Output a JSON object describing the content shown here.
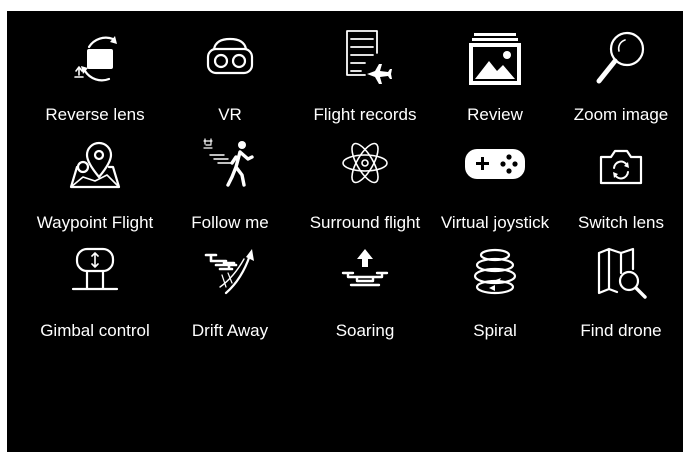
{
  "screen_title": "",
  "items": [
    {
      "id": "reverse-lens",
      "label": "Reverse lens",
      "icon": "reverse-lens-icon"
    },
    {
      "id": "vr",
      "label": "VR",
      "icon": "vr-headset-icon"
    },
    {
      "id": "flight-records",
      "label": "Flight records",
      "icon": "flight-records-icon"
    },
    {
      "id": "review",
      "label": "Review",
      "icon": "image-gallery-icon"
    },
    {
      "id": "zoom-image",
      "label": "Zoom image",
      "icon": "magnifier-icon"
    },
    {
      "id": "waypoint-flight",
      "label": "Waypoint Flight",
      "icon": "map-pin-icon"
    },
    {
      "id": "follow-me",
      "label": "Follow me",
      "icon": "follow-walker-icon"
    },
    {
      "id": "surround-flight",
      "label": "Surround flight",
      "icon": "orbit-atom-icon"
    },
    {
      "id": "virtual-joystick",
      "label": "Virtual joystick",
      "icon": "gamepad-icon"
    },
    {
      "id": "switch-lens",
      "label": "Switch lens",
      "icon": "camera-switch-icon"
    },
    {
      "id": "gimbal-control",
      "label": "Gimbal control",
      "icon": "gimbal-icon"
    },
    {
      "id": "drift-away",
      "label": "Drift Away",
      "icon": "drone-drift-icon"
    },
    {
      "id": "soaring",
      "label": "Soaring",
      "icon": "drone-ascend-icon"
    },
    {
      "id": "spiral",
      "label": "Spiral",
      "icon": "spiral-icon"
    },
    {
      "id": "find-drone",
      "label": "Find drone",
      "icon": "find-drone-map-icon"
    }
  ],
  "colors": {
    "background": "#000000",
    "foreground": "#ffffff",
    "page": "#ffffff"
  }
}
